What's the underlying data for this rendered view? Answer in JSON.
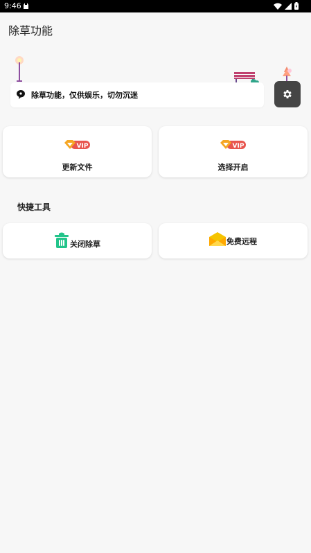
{
  "status_bar": {
    "time": "9:46",
    "icons": [
      "app-notification-icon",
      "wifi-icon",
      "signal-icon",
      "battery-icon"
    ]
  },
  "app_title": "除草功能",
  "notice": {
    "icon": "chat-bubble-icon",
    "text": "除草功能，仅供娱乐，切勿沉迷"
  },
  "settings": {
    "icon": "gear-icon"
  },
  "vip_tiles": [
    {
      "badge": "VIP",
      "label": "更新文件"
    },
    {
      "badge": "VIP",
      "label": "选择开启"
    }
  ],
  "section_title": "快捷工具",
  "tools": [
    {
      "icon": "trash-bin-icon",
      "label": "关闭除草"
    },
    {
      "icon": "envelope-icon",
      "label": "免费远程"
    }
  ],
  "colors": {
    "status_bar": "#000000",
    "background": "#f7f7f7",
    "settings_button": "#454545",
    "vip_orange": "#f5a623",
    "vip_red": "#e8554e",
    "trash_green": "#22c48a",
    "envelope_yellow": "#f5c400"
  }
}
